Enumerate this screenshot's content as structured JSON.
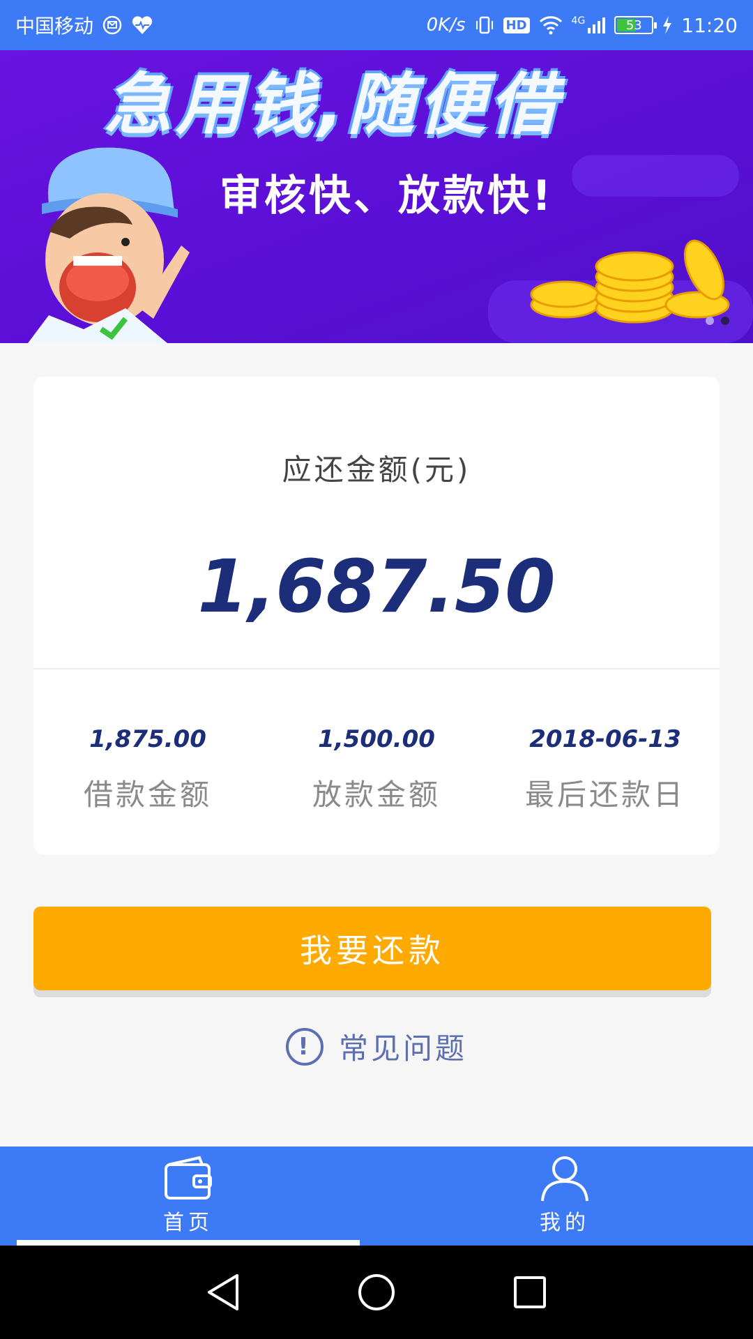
{
  "status_bar": {
    "carrier": "中国移动",
    "net_speed": "0K/s",
    "network_type": "4G",
    "battery_level": "53",
    "time": "11:20",
    "hd_label": "HD"
  },
  "banner": {
    "headline": "急用钱,随便借",
    "subheadline": "审核快、放款快!",
    "slide_count": 2,
    "active_slide": 2
  },
  "repayment_card": {
    "title": "应还金额(元)",
    "amount": "1,687.50",
    "stats": [
      {
        "value": "1,875.00",
        "label": "借款金额"
      },
      {
        "value": "1,500.00",
        "label": "放款金额"
      },
      {
        "value": "2018-06-13",
        "label": "最后还款日"
      }
    ]
  },
  "actions": {
    "repay_label": "我要还款",
    "faq_label": "常见问题",
    "faq_icon_glyph": "!"
  },
  "bottom_nav": {
    "items": [
      {
        "label": "首页",
        "icon": "wallet-icon",
        "active": true
      },
      {
        "label": "我的",
        "icon": "person-icon",
        "active": false
      }
    ]
  },
  "colors": {
    "primary_blue": "#3d7af5",
    "accent_orange": "#ffaa00",
    "amount_navy": "#1c2e7a",
    "banner_purple": "#5a0fd6"
  }
}
